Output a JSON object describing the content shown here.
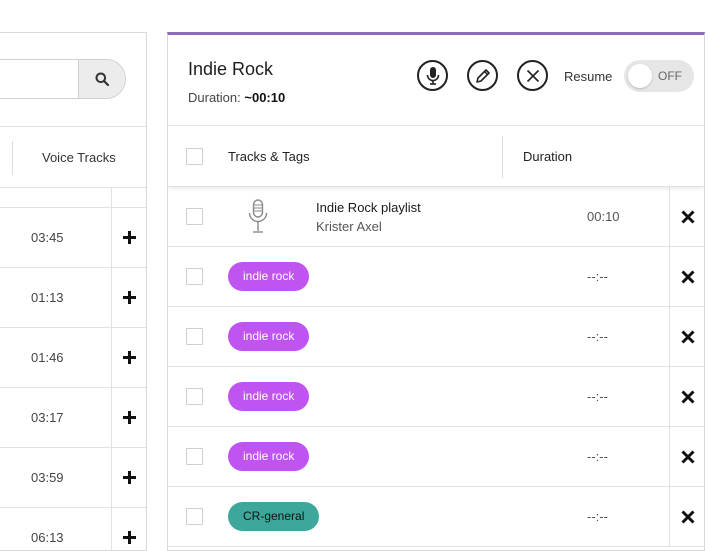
{
  "library": {
    "column_header": "Voice Tracks",
    "rows": [
      {
        "duration": "03:45"
      },
      {
        "duration": "01:13"
      },
      {
        "duration": "01:46"
      },
      {
        "duration": "03:17"
      },
      {
        "duration": "03:59"
      },
      {
        "duration": "06:13"
      }
    ]
  },
  "playlist": {
    "title": "Indie Rock",
    "duration_label": "Duration:",
    "duration_value": "~00:10",
    "resume_label": "Resume",
    "toggle_state": "OFF",
    "accent_color": "#8e6bbf",
    "columns": {
      "tracks": "Tracks & Tags",
      "duration": "Duration"
    },
    "voice_track": {
      "title": "Indie Rock playlist",
      "artist": "Krister Axel",
      "duration": "00:10",
      "icon": "microphone-icon"
    },
    "tags": [
      {
        "label": "indie rock",
        "duration": "--:--",
        "color": "#c054f0",
        "text_color": "#ffffff"
      },
      {
        "label": "indie rock",
        "duration": "--:--",
        "color": "#c054f0",
        "text_color": "#ffffff"
      },
      {
        "label": "indie rock",
        "duration": "--:--",
        "color": "#c054f0",
        "text_color": "#ffffff"
      },
      {
        "label": "indie rock",
        "duration": "--:--",
        "color": "#c054f0",
        "text_color": "#ffffff"
      },
      {
        "label": "CR-general",
        "duration": "--:--",
        "color": "#3ea79b",
        "text_color": "#111111"
      }
    ]
  }
}
